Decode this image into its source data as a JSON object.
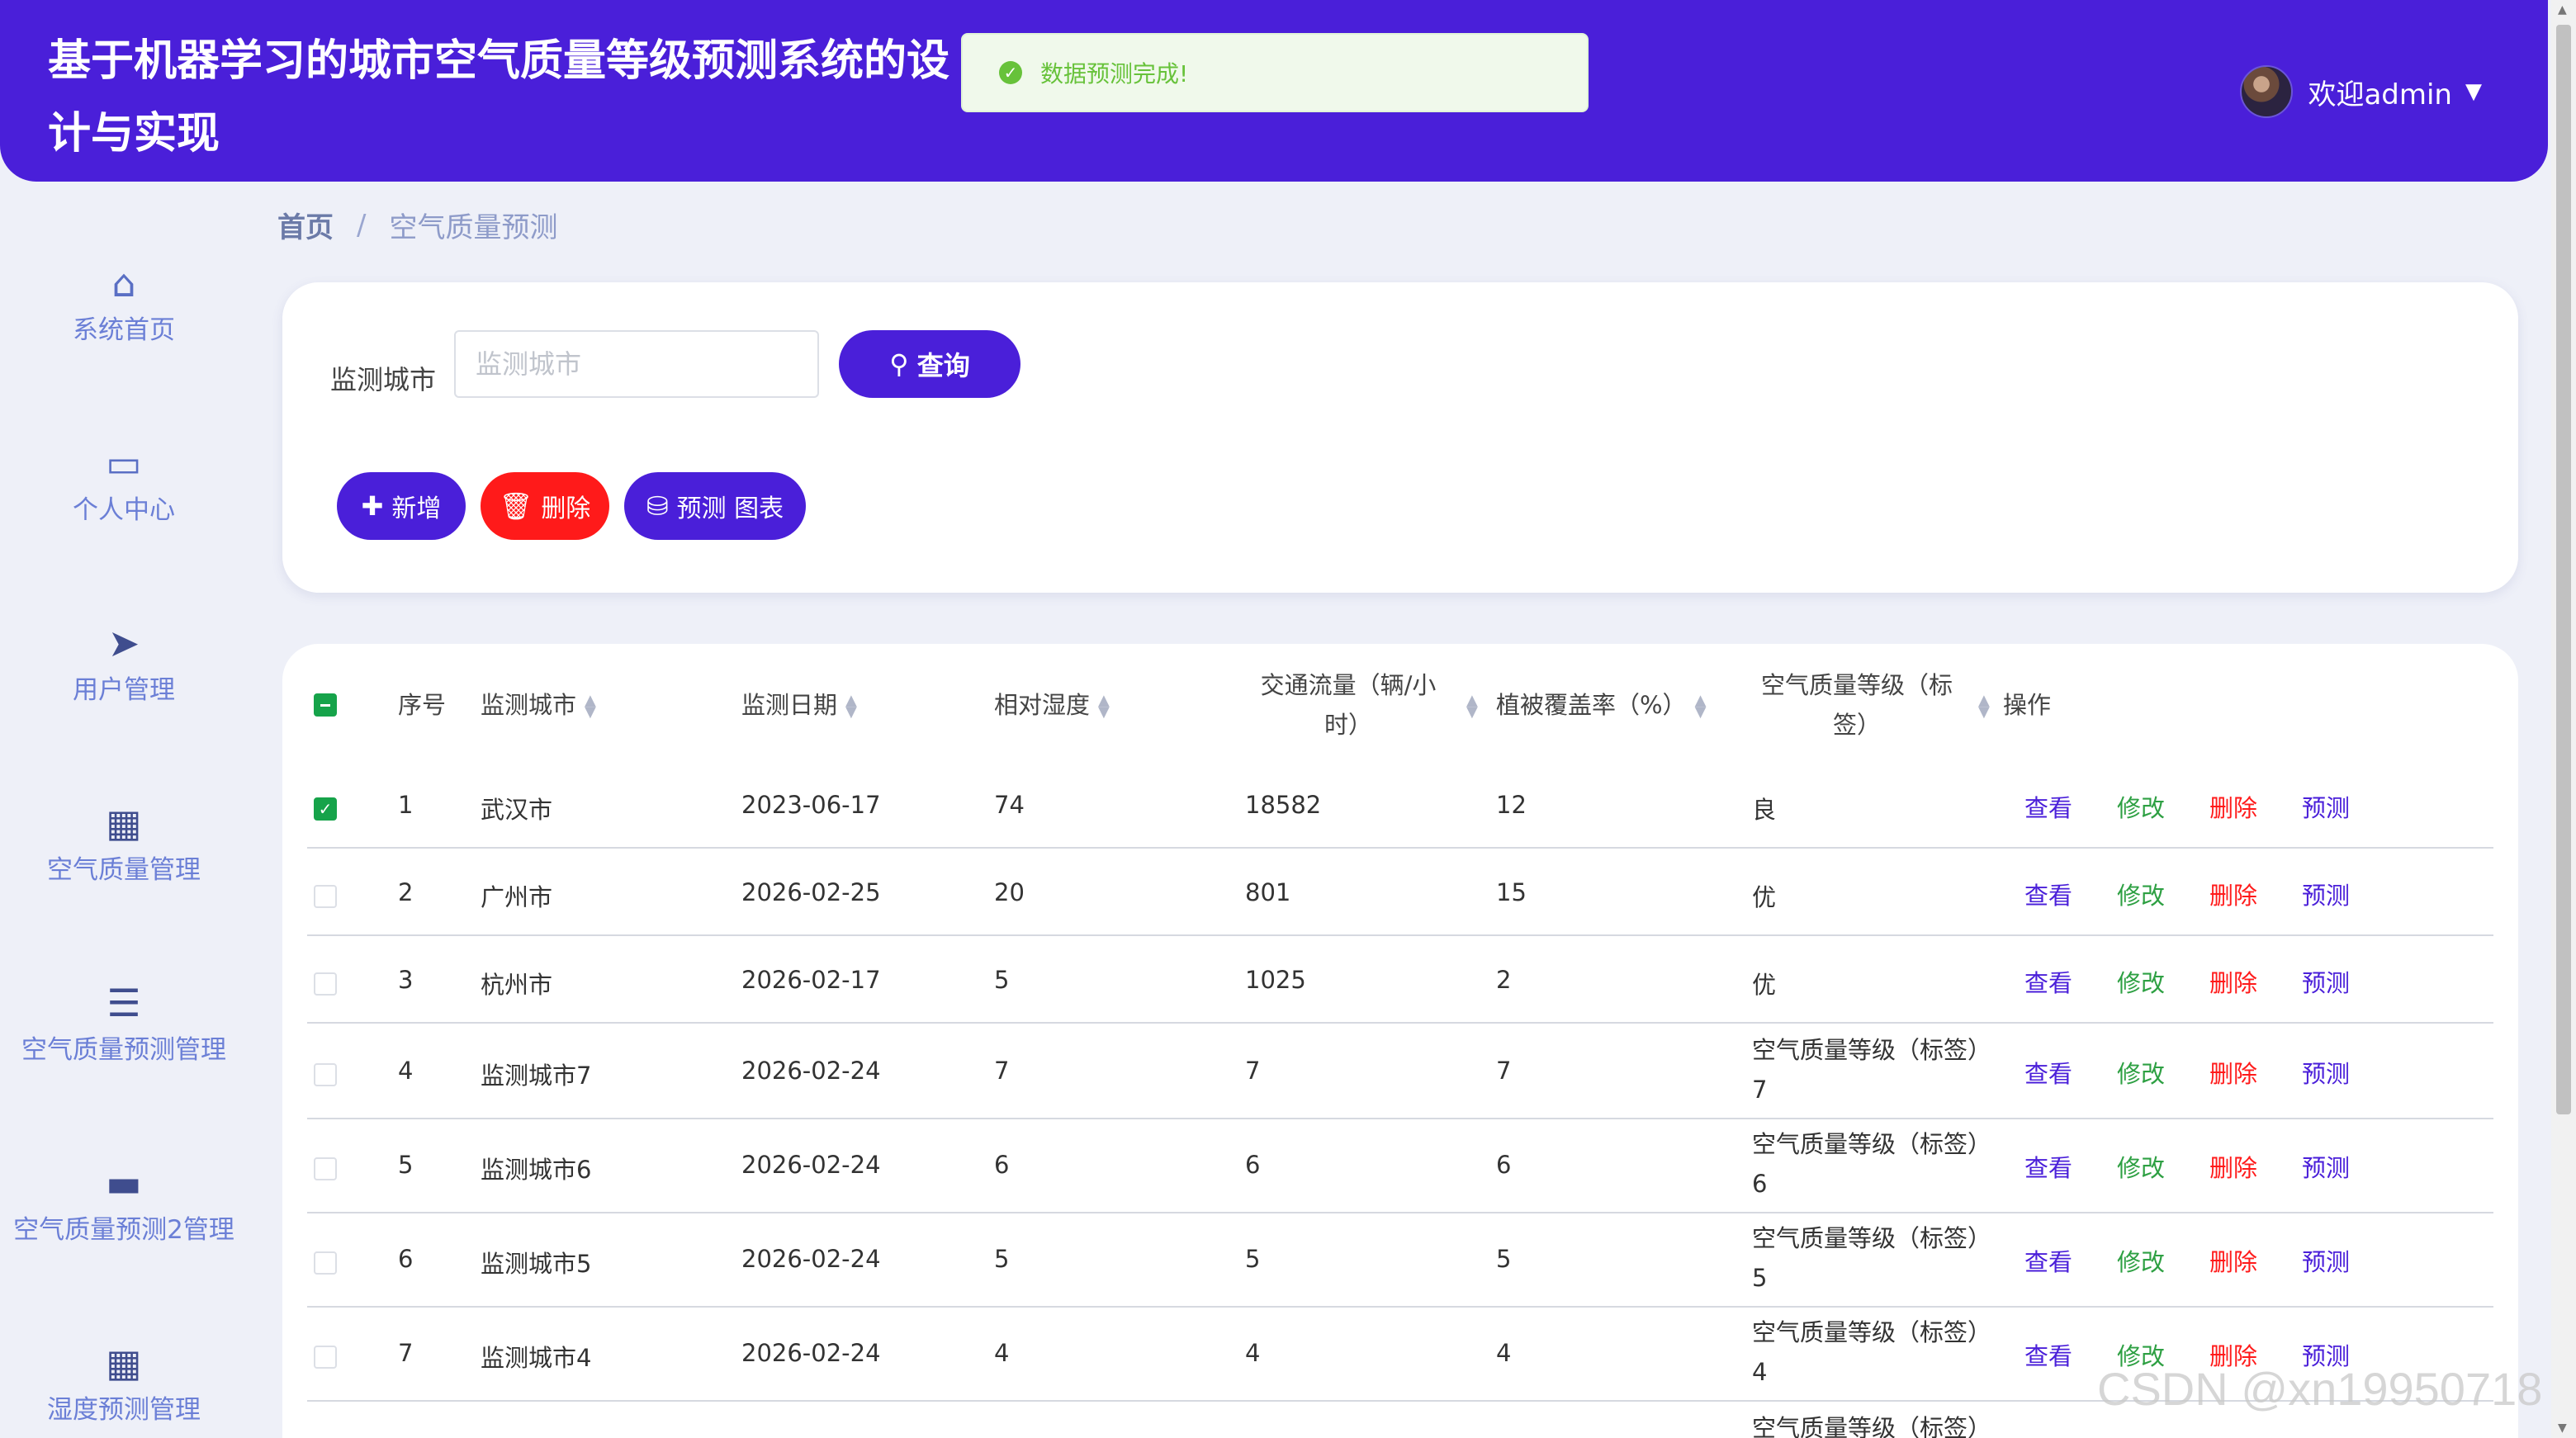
{
  "header": {
    "title": "基于机器学习的城市空气质量等级预测系统的设计与实现",
    "welcome": "欢迎admin",
    "caret_icon": "caret-down-icon"
  },
  "toast": {
    "message": "数据预测完成!"
  },
  "sidebar": {
    "items": [
      {
        "label": "系统首页",
        "icon": "home-icon"
      },
      {
        "label": "个人中心",
        "icon": "card-icon"
      },
      {
        "label": "用户管理",
        "icon": "send-icon"
      },
      {
        "label": "空气质量管理",
        "icon": "grid-icon"
      },
      {
        "label": "空气质量预测管理",
        "icon": "list-icon"
      },
      {
        "label": "空气质量预测2管理",
        "icon": "ticket-icon"
      },
      {
        "label": "湿度预测管理",
        "icon": "grid-icon"
      }
    ]
  },
  "breadcrumb": {
    "home": "首页",
    "current": "空气质量预测"
  },
  "search": {
    "label": "监测城市",
    "placeholder": "监测城市",
    "query_label": "查询"
  },
  "actions": {
    "add": "新增",
    "delete": "删除",
    "chart": "预测 图表"
  },
  "table": {
    "headers": {
      "index": "序号",
      "city": "监测城市",
      "date": "监测日期",
      "humidity": "相对湿度",
      "traffic": "交通流量（辆/小时）",
      "vegetation": "植被覆盖率（%）",
      "aqi_level": "空气质量等级（标签）",
      "ops": "操作"
    },
    "row_actions": {
      "view": "查看",
      "edit": "修改",
      "delete": "删除",
      "predict": "预测"
    },
    "rows": [
      {
        "index": "1",
        "city": "武汉市",
        "date": "2023-06-17",
        "humidity": "74",
        "traffic": "18582",
        "vegetation": "12",
        "level": "良",
        "checked": true
      },
      {
        "index": "2",
        "city": "广州市",
        "date": "2026-02-25",
        "humidity": "20",
        "traffic": "801",
        "vegetation": "15",
        "level": "优",
        "checked": false
      },
      {
        "index": "3",
        "city": "杭州市",
        "date": "2026-02-17",
        "humidity": "5",
        "traffic": "1025",
        "vegetation": "2",
        "level": "优",
        "checked": false
      },
      {
        "index": "4",
        "city": "监测城市7",
        "date": "2026-02-24",
        "humidity": "7",
        "traffic": "7",
        "vegetation": "7",
        "level": "空气质量等级（标签）7",
        "checked": false
      },
      {
        "index": "5",
        "city": "监测城市6",
        "date": "2026-02-24",
        "humidity": "6",
        "traffic": "6",
        "vegetation": "6",
        "level": "空气质量等级（标签）6",
        "checked": false
      },
      {
        "index": "6",
        "city": "监测城市5",
        "date": "2026-02-24",
        "humidity": "5",
        "traffic": "5",
        "vegetation": "5",
        "level": "空气质量等级（标签）5",
        "checked": false
      },
      {
        "index": "7",
        "city": "监测城市4",
        "date": "2026-02-24",
        "humidity": "4",
        "traffic": "4",
        "vegetation": "4",
        "level": "空气质量等级（标签）4",
        "checked": false
      },
      {
        "index": "",
        "city": "",
        "date": "",
        "humidity": "",
        "traffic": "",
        "vegetation": "",
        "level": "空气质量等级（标签）",
        "checked": false
      }
    ]
  },
  "watermark": "CSDN @xn19950718"
}
